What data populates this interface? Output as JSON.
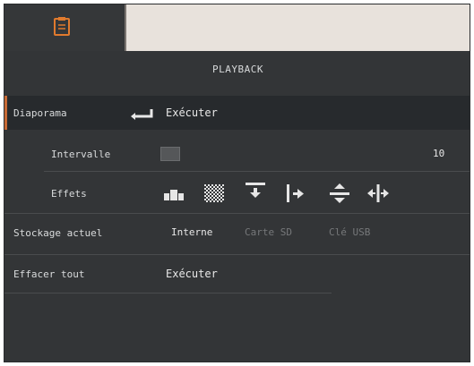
{
  "tabs": {
    "active_icon": "clipboard-icon"
  },
  "header": {
    "title": "PLAYBACK"
  },
  "diaporama": {
    "label": "Diaporama",
    "action": "Exécuter"
  },
  "intervalle": {
    "label": "Intervalle",
    "value": "10",
    "level": 0.0
  },
  "effets": {
    "label": "Effets",
    "icons": [
      "bars-effect-icon",
      "dissolve-effect-icon",
      "wipe-down-effect-icon",
      "wipe-right-effect-icon",
      "split-vertical-effect-icon",
      "split-horizontal-effect-icon"
    ]
  },
  "stockage": {
    "label": "Stockage actuel",
    "options": [
      "Interne",
      "Carte SD",
      "Clé USB"
    ],
    "selected": "Interne"
  },
  "effacer": {
    "label": "Effacer tout",
    "action": "Exécuter"
  },
  "colors": {
    "accent": "#e07a2e",
    "selected_bar": "#c96a36",
    "background": "#333537"
  }
}
